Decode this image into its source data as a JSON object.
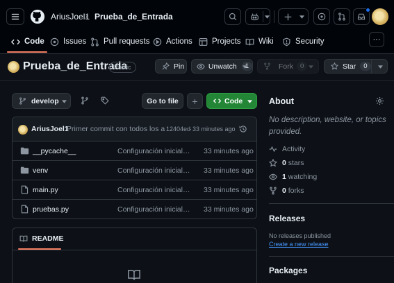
{
  "header": {
    "owner": "AriusJoel1",
    "repo": "Prueba_de_Entrada",
    "separator": "/"
  },
  "nav": {
    "tabs": [
      {
        "label": "Code",
        "icon": "code-icon"
      },
      {
        "label": "Issues",
        "icon": "issue-icon"
      },
      {
        "label": "Pull requests",
        "icon": "pull-request-icon"
      },
      {
        "label": "Actions",
        "icon": "play-icon"
      },
      {
        "label": "Projects",
        "icon": "table-icon"
      },
      {
        "label": "Wiki",
        "icon": "book-icon"
      },
      {
        "label": "Security",
        "icon": "shield-icon"
      }
    ],
    "more_label": "···"
  },
  "repo_head": {
    "title": "Prueba_de_Entrada",
    "visibility": "Public",
    "pin_label": "Pin",
    "unwatch_label": "Unwatch",
    "unwatch_count": "1",
    "fork_label": "Fork",
    "fork_count": "0",
    "star_label": "Star",
    "star_count": "0"
  },
  "toolbar": {
    "branch": "develop",
    "go_to_file": "Go to file",
    "add_label": "+",
    "code_label": "Code"
  },
  "commit": {
    "author": "AriusJoel1",
    "message": "Primer commit con todos los a...",
    "hash": "12404ed",
    "dot": "·",
    "time": "33 minutes ago"
  },
  "files": [
    {
      "name": "__pycache__",
      "type": "folder",
      "message": "Configuración inicial d...",
      "time": "33 minutes ago"
    },
    {
      "name": "venv",
      "type": "folder",
      "message": "Configuración inicial d...",
      "time": "33 minutes ago"
    },
    {
      "name": "main.py",
      "type": "file",
      "message": "Configuración inicial d...",
      "time": "33 minutes ago"
    },
    {
      "name": "pruebas.py",
      "type": "file",
      "message": "Configuración inicial d...",
      "time": "33 minutes ago"
    }
  ],
  "readme": {
    "tab_label": "README"
  },
  "about": {
    "title": "About",
    "description": "No description, website, or topics provided.",
    "activity": "Activity",
    "stars_count": "0",
    "stars_label": "stars",
    "watching_count": "1",
    "watching_label": "watching",
    "forks_count": "0",
    "forks_label": "forks"
  },
  "releases": {
    "title": "Releases",
    "none_text": "No releases published",
    "create_link": "Create a new release"
  },
  "packages": {
    "title": "Packages"
  },
  "colors": {
    "accent_green": "#238636",
    "link_blue": "#4493f8",
    "tab_underline": "#f78166",
    "notification_dot": "#1f6feb"
  }
}
